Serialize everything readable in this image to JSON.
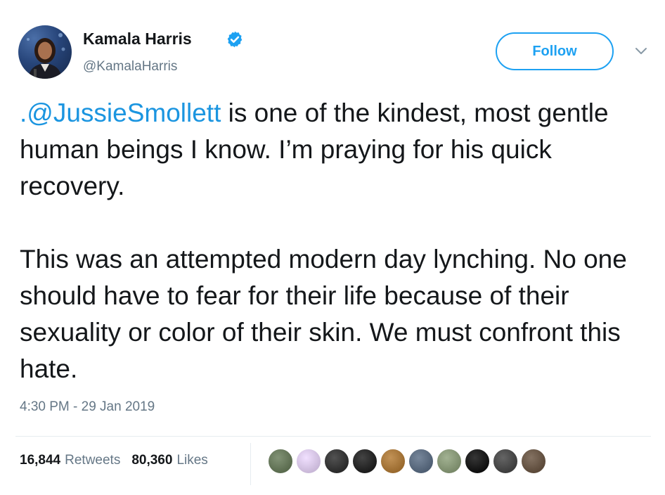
{
  "author": {
    "name": "Kamala Harris",
    "handle": "@KamalaHarris",
    "verified": true,
    "avatar_icon": "user-avatar-photo"
  },
  "follow_button": {
    "label": "Follow"
  },
  "menu_icon": "chevron-down-icon",
  "tweet": {
    "mention": ".@JussieSmollett",
    "paragraph1_rest": " is one of the kindest, most gentle human beings I know. I’m praying for his quick recovery.",
    "paragraph2": "This was an attempted modern day lynching. No one should have to fear for their life because of their sexuality or color of their skin. We must confront this hate."
  },
  "timestamp": "4:30 PM - 29 Jan 2019",
  "stats": {
    "retweets_count": "16,844",
    "retweets_label": "Retweets",
    "likes_count": "80,360",
    "likes_label": "Likes"
  },
  "likers": [
    {
      "icon": "liker-avatar-1",
      "color": "#5a6b4e"
    },
    {
      "icon": "liker-avatar-2",
      "color": "#c9b8d8"
    },
    {
      "icon": "liker-avatar-3",
      "color": "#2a2a2a"
    },
    {
      "icon": "liker-avatar-4",
      "color": "#1c1c1c"
    },
    {
      "icon": "liker-avatar-5",
      "color": "#9a6a2e"
    },
    {
      "icon": "liker-avatar-6",
      "color": "#4f5f73"
    },
    {
      "icon": "liker-avatar-7",
      "color": "#7a8a6a"
    },
    {
      "icon": "liker-avatar-8",
      "color": "#0e0e0e"
    },
    {
      "icon": "liker-avatar-9",
      "color": "#3d3d3d"
    },
    {
      "icon": "liker-avatar-10",
      "color": "#5c4a3a"
    }
  ],
  "colors": {
    "accent": "#1da1f2",
    "mention": "#1b95e0",
    "text": "#14171a",
    "secondary": "#657786"
  }
}
